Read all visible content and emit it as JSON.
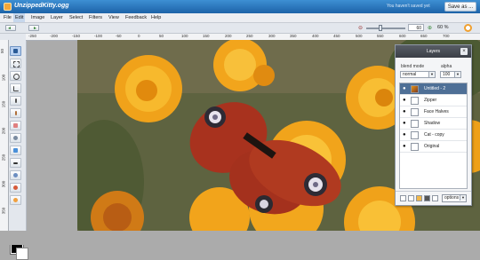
{
  "app": {
    "title": "UnzippedKitty.ogg",
    "unsaved_note": "You haven't saved yet",
    "save_as_label": "Save as ..."
  },
  "menu": [
    "File",
    "Edit",
    "Image",
    "Layer",
    "Select",
    "Filters",
    "View",
    "Feedback",
    "Help"
  ],
  "menu_active_index": 1,
  "toolbar": {
    "zoom_value": "60",
    "zoom_percent": "60 %",
    "zoom_minus_icon": "zoom-out-icon",
    "zoom_plus_icon": "zoom-in-icon"
  },
  "rulers": {
    "horizontal": [
      "-250",
      "-200",
      "-150",
      "-100",
      "-50",
      "0",
      "50",
      "100",
      "150",
      "200",
      "250",
      "300",
      "350",
      "400",
      "450",
      "500",
      "550",
      "600",
      "650",
      "700"
    ],
    "vertical": [
      "50",
      "100",
      "150",
      "200",
      "250",
      "300",
      "350"
    ]
  },
  "tools": [
    "move-tool-icon",
    "select-tool-icon",
    "lasso-tool-icon",
    "crop-tool-icon",
    "eyedropper-tool-icon",
    "brush-tool-icon",
    "eraser-tool-icon",
    "clone-tool-icon",
    "fill-tool-icon",
    "text-tool-icon",
    "shape-tool-icon",
    "smudge-tool-icon",
    "dodge-tool-icon"
  ],
  "colors": {
    "foreground": "#000000",
    "background": "#ffffff",
    "accent": "#1d63a8",
    "selected_layer": "#4e6f96"
  },
  "layers_panel": {
    "title": "Layers",
    "close_label": "×",
    "blend_mode_label": "blend mode",
    "blend_mode_value": "normal",
    "alpha_label": "alpha",
    "alpha_value": "100",
    "options_label": "options",
    "layers": [
      {
        "name": "Untitled - 2",
        "selected": true
      },
      {
        "name": "Zipper",
        "selected": false
      },
      {
        "name": "Face Halves",
        "selected": false
      },
      {
        "name": "Shadow",
        "selected": false
      },
      {
        "name": "Cat - copy",
        "selected": false
      },
      {
        "name": "Original",
        "selected": false
      }
    ]
  }
}
